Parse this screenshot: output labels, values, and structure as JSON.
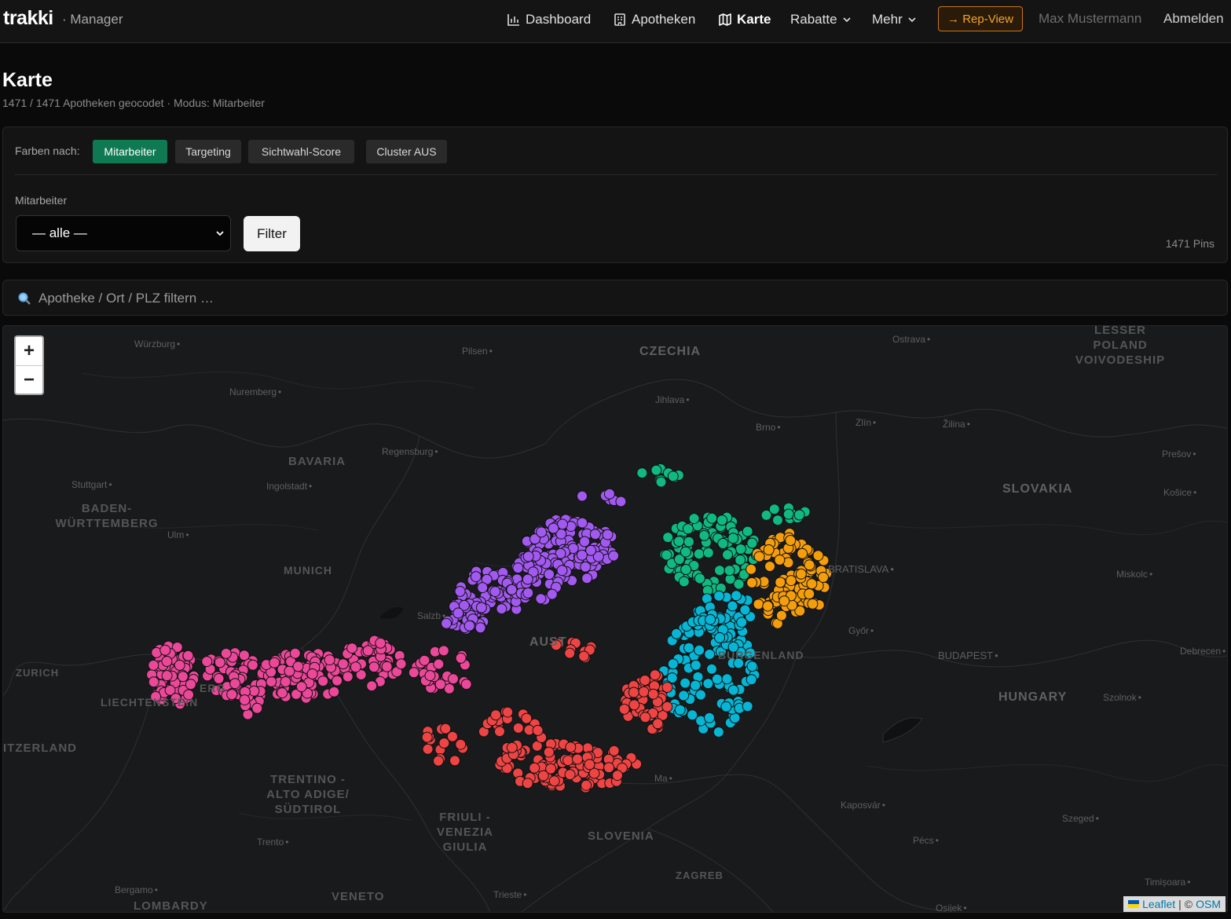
{
  "header": {
    "brand": "trakki",
    "brand_sub": "· Manager",
    "nav": [
      {
        "label": "Dashboard",
        "icon": "bar-chart-icon"
      },
      {
        "label": "Apotheken",
        "icon": "building-icon"
      },
      {
        "label": "Karte",
        "icon": "map-icon",
        "active": true
      },
      {
        "label": "Rabatte",
        "icon": "chevron-down-icon"
      },
      {
        "label": "Mehr",
        "icon": "chevron-down-icon"
      }
    ],
    "rep_view": "→ Rep-View",
    "user": "Max Mustermann",
    "logout": "Abmelden"
  },
  "page": {
    "title": "Karte",
    "subtitle": "1471 / 1471 Apotheken geocodet · Modus: Mitarbeiter"
  },
  "controls": {
    "color_label": "Farben nach:",
    "modes": [
      "Mitarbeiter",
      "Targeting",
      "Sichtwahl-Score",
      "Cluster AUS"
    ],
    "active_mode": "Mitarbeiter",
    "employee_label": "Mitarbeiter",
    "employee_select": "— alle —",
    "filter_button": "Filter",
    "pin_count": "1471 Pins"
  },
  "search": {
    "placeholder": "Apotheke / Ort / PLZ filtern …"
  },
  "map": {
    "zoom_in": "+",
    "zoom_out": "−",
    "attribution": {
      "leaflet": "Leaflet",
      "separator": "|",
      "copyright": "©",
      "osm": "OSM"
    },
    "labels": {
      "wurzburg": "Würzburg",
      "pilsen": "Pilsen",
      "czechia": "CZECHIA",
      "ostrava": "Ostrava",
      "lesser_poland": "LESSER POLAND VOIVODESHIP",
      "nuremberg": "Nuremberg",
      "jihlava": "Jihlava",
      "brno": "Brno",
      "zlin": "Zlín",
      "zilina": "Žilina",
      "bavaria": "BAVARIA",
      "regensburg": "Regensburg",
      "presov": "Prešov",
      "stuttgart": "Stuttgart",
      "ingolstadt": "Ingolstadt",
      "slovakia": "SLOVAKIA",
      "kosice": "Košice",
      "baden": "BADEN- WÜRTTEMBERG",
      "ulm": "Ulm",
      "munich": "MUNICH",
      "bratislava": "BRATISLAVA",
      "miskolc": "Miskolc",
      "salzburg": "Salzb",
      "gyor": "Győr",
      "zurich": "ZURICH",
      "austria": "AUST",
      "burgenland": "BURGENLAND",
      "budapest": "BUDAPEST",
      "debrecen": "Debrecen",
      "liechtenstein": "LIECHTENSTEIN",
      "vorarlberg": "ERG",
      "hungary": "HUNGARY",
      "szolnok": "Szolnok",
      "switzerland": "ITZERLAND",
      "trentino": "TRENTINO - ALTO ADIGE/ SÜDTIROL",
      "kaposvar": "Kaposvár",
      "szeged": "Szeged",
      "friuli": "FRIULI - VENEZIA GIULIA",
      "slovenia": "SLOVENIA",
      "trento": "Trento",
      "pecs": "Pécs",
      "zagreb": "ZAGREB",
      "bergamo": "Bergamo",
      "veneto": "VENETO",
      "trieste": "Trieste",
      "lombardy": "LOMBARDY",
      "timisoara": "Timișoara",
      "osijek": "Osijek",
      "maribor": "Ma"
    },
    "employee_colors": {
      "purple": "#a259f0",
      "green": "#10b981",
      "orange": "#f59e0b",
      "cyan": "#06b6d4",
      "pink": "#ec4899",
      "red": "#ef4444"
    }
  }
}
